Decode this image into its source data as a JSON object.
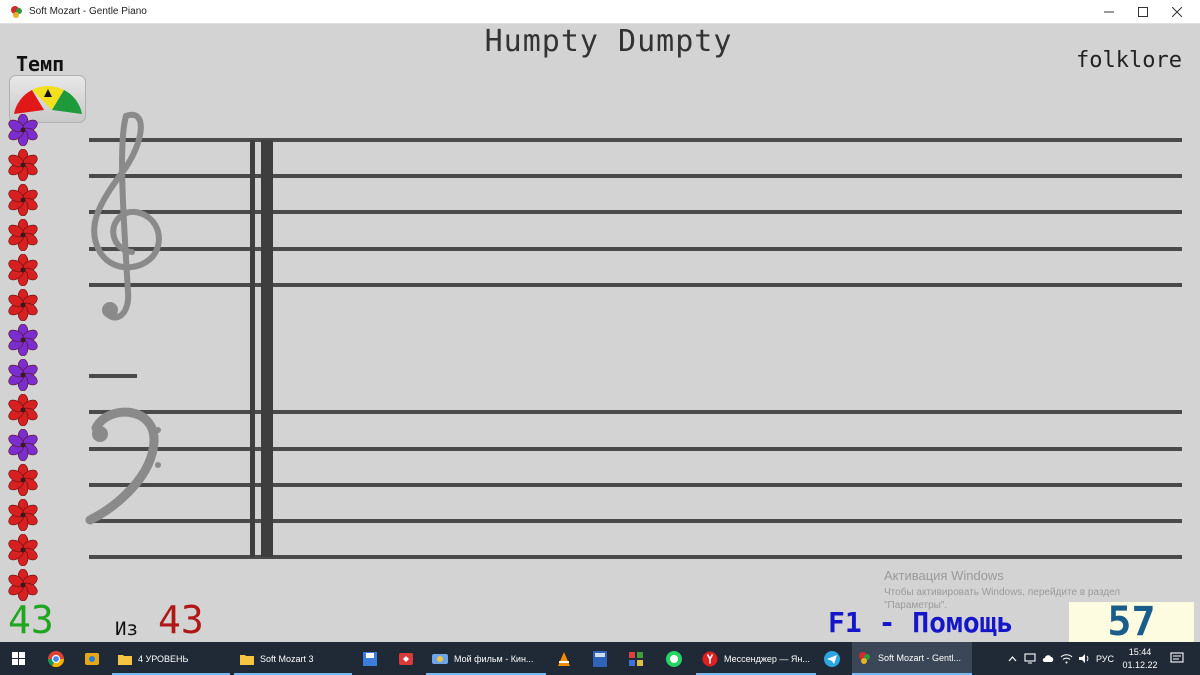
{
  "window": {
    "title": "Soft Mozart - Gentle Piano",
    "minimize_glyph": "—",
    "maximize_glyph": "☐",
    "close_glyph": "✕"
  },
  "score_sheet": {
    "song_title": "Humpty Dumpty",
    "composer": "folklore",
    "tempo_label": "Темп",
    "flowers": [
      "purple",
      "red",
      "red",
      "red",
      "red",
      "red",
      "purple",
      "purple",
      "red",
      "purple",
      "red",
      "red",
      "red",
      "red"
    ]
  },
  "score": {
    "correct": "43",
    "of_label": "Из",
    "total": "43",
    "help_label": "F1 - Помощь",
    "counter": "57"
  },
  "activation_notice": {
    "title": "Активация Windows",
    "text": "Чтобы активировать Windows, перейдите в раздел \"Параметры\"."
  },
  "taskbar": {
    "apps": [
      {
        "label": "4 УРОВЕНЬ"
      },
      {
        "label": "Soft Mozart 3"
      },
      {
        "label": "Мой фильм - Кин..."
      },
      {
        "label": "Мессенджер — Ян..."
      },
      {
        "label": "Soft Mozart - Gentl..."
      }
    ],
    "tray": {
      "language": "РУС",
      "time": "15:44",
      "date": "01.12.22"
    }
  },
  "colors": {
    "correct_green": "#1fa51f",
    "total_red": "#b01818",
    "help_blue": "#1515c9",
    "counter_blue": "#1a5c8a",
    "staff_line": "#4a4a4a",
    "flower_red": "#d92020",
    "flower_purple": "#7a2ed0"
  },
  "icons": {
    "app": "soft-mozart-app-icon",
    "start": "windows-start-icon",
    "chrome": "chrome-icon",
    "explorer": "file-explorer-icon"
  }
}
